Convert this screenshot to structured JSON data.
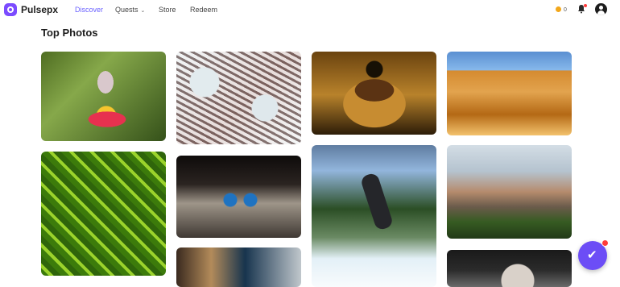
{
  "brand": {
    "name": "Pulsepx"
  },
  "nav": [
    {
      "label": "Discover",
      "active": true
    },
    {
      "label": "Quests",
      "has_dropdown": true
    },
    {
      "label": "Store"
    },
    {
      "label": "Redeem"
    }
  ],
  "header": {
    "coins": "0",
    "has_notifications": true
  },
  "section": {
    "title": "Top Photos"
  },
  "photos": [
    {
      "subject": "butterfly-on-flower"
    },
    {
      "subject": "winding-road-aerial"
    },
    {
      "subject": "jumping-spider-closeup"
    },
    {
      "subject": "sand-dunes"
    },
    {
      "subject": "palm-leaf-pattern"
    },
    {
      "subject": "blue-butterfly-on-rock"
    },
    {
      "subject": "snowboarder"
    },
    {
      "subject": "rock-formation-pines"
    },
    {
      "subject": "train-platform"
    },
    {
      "subject": "grey-haired-person"
    }
  ],
  "colors": {
    "accent": "#6c4df6",
    "active_nav": "#6b62ff",
    "notification": "#ff3b3b",
    "coin": "#f2a71b"
  }
}
